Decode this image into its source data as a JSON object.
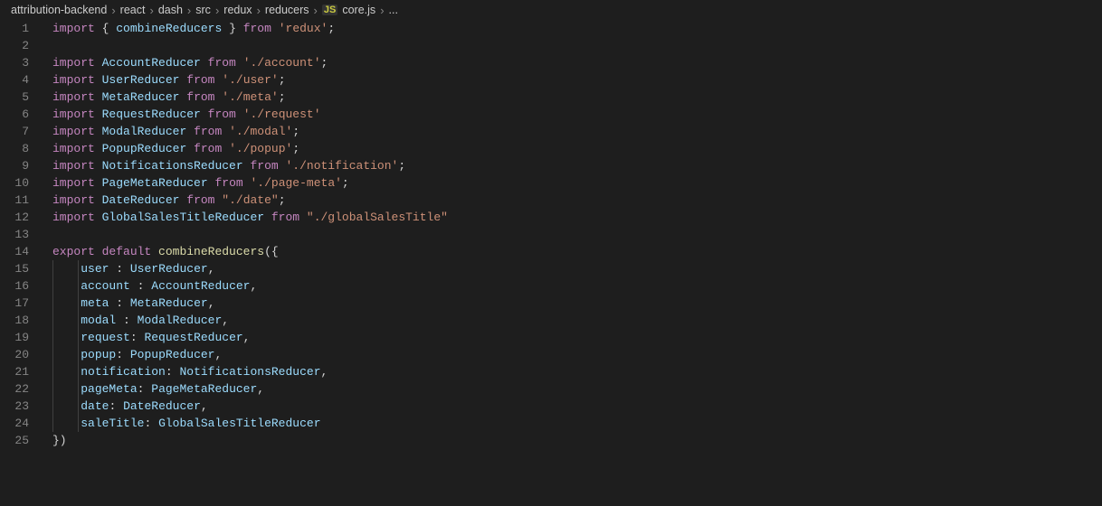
{
  "breadcrumb": {
    "parts": [
      "attribution-backend",
      "react",
      "dash",
      "src",
      "redux",
      "reducers"
    ],
    "fileIconLabel": "JS",
    "file": "core.js",
    "tail": "..."
  },
  "code": {
    "lines": [
      {
        "n": 1,
        "html": "<span class='kw'>import</span> <span class='punc'>{ </span><span class='var'>combineReducers</span><span class='punc'> }</span> <span class='kw'>from</span> <span class='str'>'redux'</span><span class='punc'>;</span>"
      },
      {
        "n": 2,
        "html": ""
      },
      {
        "n": 3,
        "html": "<span class='kw'>import</span> <span class='var'>AccountReducer</span> <span class='kw'>from</span> <span class='str'>'./account'</span><span class='punc'>;</span>"
      },
      {
        "n": 4,
        "html": "<span class='kw'>import</span> <span class='var'>UserReducer</span> <span class='kw'>from</span> <span class='str'>'./user'</span><span class='punc'>;</span>"
      },
      {
        "n": 5,
        "html": "<span class='kw'>import</span> <span class='var'>MetaReducer</span> <span class='kw'>from</span> <span class='str'>'./meta'</span><span class='punc'>;</span>"
      },
      {
        "n": 6,
        "html": "<span class='kw'>import</span> <span class='var'>RequestReducer</span> <span class='kw'>from</span> <span class='str'>'./request'</span>"
      },
      {
        "n": 7,
        "html": "<span class='kw'>import</span> <span class='var'>ModalReducer</span> <span class='kw'>from</span> <span class='str'>'./modal'</span><span class='punc'>;</span>"
      },
      {
        "n": 8,
        "html": "<span class='kw'>import</span> <span class='var'>PopupReducer</span> <span class='kw'>from</span> <span class='str'>'./popup'</span><span class='punc'>;</span>"
      },
      {
        "n": 9,
        "html": "<span class='kw'>import</span> <span class='var'>NotificationsReducer</span> <span class='kw'>from</span> <span class='str'>'./notification'</span><span class='punc'>;</span>"
      },
      {
        "n": 10,
        "html": "<span class='kw'>import</span> <span class='var'>PageMetaReducer</span> <span class='kw'>from</span> <span class='str'>'./page-meta'</span><span class='punc'>;</span>"
      },
      {
        "n": 11,
        "html": "<span class='kw'>import</span> <span class='var'>DateReducer</span> <span class='kw'>from</span> <span class='str'>\"./date\"</span><span class='punc'>;</span>"
      },
      {
        "n": 12,
        "html": "<span class='kw'>import</span> <span class='var'>GlobalSalesTitleReducer</span> <span class='kw'>from</span> <span class='str'>\"./globalSalesTitle\"</span>"
      },
      {
        "n": 13,
        "html": ""
      },
      {
        "n": 14,
        "html": "<span class='kw'>export</span> <span class='kw'>default</span> <span class='fn'>combineReducers</span><span class='punc'>({</span>"
      },
      {
        "n": 15,
        "html": "    <span class='var'>user</span> <span class='punc'>:</span> <span class='var'>UserReducer</span><span class='punc'>,</span>",
        "indent": true
      },
      {
        "n": 16,
        "html": "    <span class='var'>account</span> <span class='punc'>:</span> <span class='var'>AccountReducer</span><span class='punc'>,</span>",
        "indent": true
      },
      {
        "n": 17,
        "html": "    <span class='var'>meta</span> <span class='punc'>:</span> <span class='var'>MetaReducer</span><span class='punc'>,</span>",
        "indent": true
      },
      {
        "n": 18,
        "html": "    <span class='var'>modal</span> <span class='punc'>:</span> <span class='var'>ModalReducer</span><span class='punc'>,</span>",
        "indent": true
      },
      {
        "n": 19,
        "html": "    <span class='var'>request</span><span class='punc'>:</span> <span class='var'>RequestReducer</span><span class='punc'>,</span>",
        "indent": true
      },
      {
        "n": 20,
        "html": "    <span class='var'>popup</span><span class='punc'>:</span> <span class='var'>PopupReducer</span><span class='punc'>,</span>",
        "indent": true
      },
      {
        "n": 21,
        "html": "    <span class='var'>notification</span><span class='punc'>:</span> <span class='var'>NotificationsReducer</span><span class='punc'>,</span>",
        "indent": true
      },
      {
        "n": 22,
        "html": "    <span class='var'>pageMeta</span><span class='punc'>:</span> <span class='var'>PageMetaReducer</span><span class='punc'>,</span>",
        "indent": true
      },
      {
        "n": 23,
        "html": "    <span class='var'>date</span><span class='punc'>:</span> <span class='var'>DateReducer</span><span class='punc'>,</span>",
        "indent": true
      },
      {
        "n": 24,
        "html": "    <span class='var'>saleTitle</span><span class='punc'>:</span> <span class='var'>GlobalSalesTitleReducer</span>",
        "indent": true
      },
      {
        "n": 25,
        "html": "<span class='punc'>})</span>"
      }
    ]
  }
}
